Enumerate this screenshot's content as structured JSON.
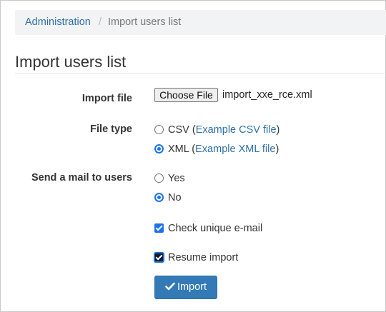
{
  "breadcrumb": {
    "root": "Administration",
    "separator": "/",
    "current": "Import users list"
  },
  "page": {
    "title": "Import users list"
  },
  "form": {
    "import_file": {
      "label": "Import file",
      "button_label": "Choose File",
      "file_name": "import_xxe_rce.xml"
    },
    "file_type": {
      "label": "File type",
      "options": [
        {
          "name": "CSV",
          "open": " (",
          "link": "Example CSV file",
          "close": ")",
          "checked": false
        },
        {
          "name": "XML",
          "open": " (",
          "link": "Example XML file",
          "close": ")",
          "checked": true
        }
      ]
    },
    "send_mail": {
      "label": "Send a mail to users",
      "options": [
        {
          "name": "Yes",
          "checked": false
        },
        {
          "name": "No",
          "checked": true
        }
      ]
    },
    "check_unique_email": {
      "label": "Check unique e-mail",
      "checked": true
    },
    "resume_import": {
      "label": "Resume import",
      "checked": true
    },
    "submit": {
      "label": "Import",
      "icon": "check-icon"
    }
  },
  "colors": {
    "link": "#2f6fa6",
    "primary_button": "#337ab7",
    "control_accent": "#1a73e8"
  }
}
